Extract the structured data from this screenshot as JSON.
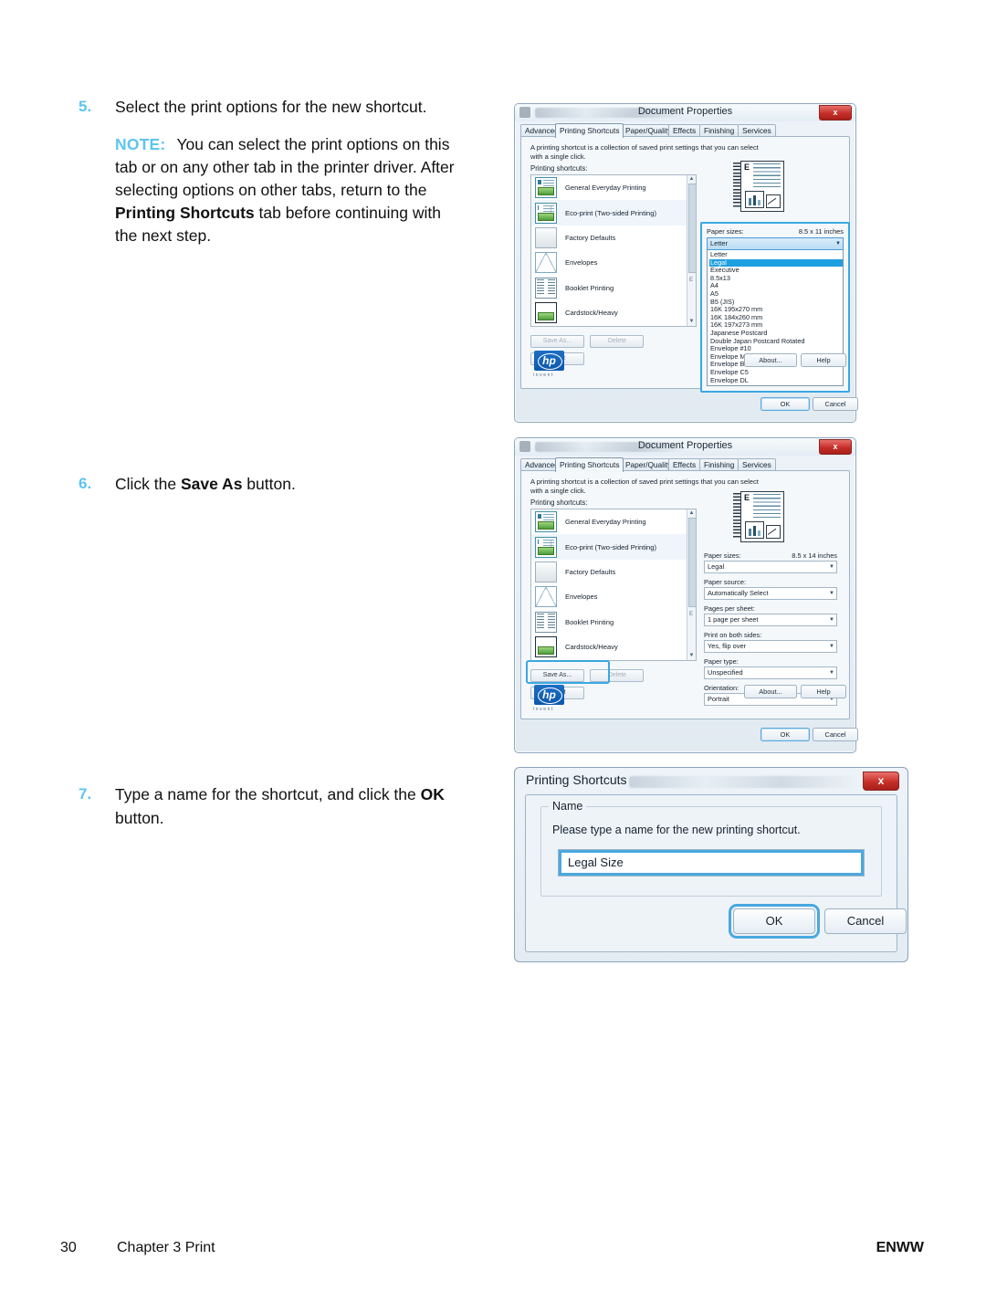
{
  "document": {
    "footer": {
      "page_number": "30",
      "chapter": "Chapter 3   Print",
      "guide_code": "ENWW"
    }
  },
  "steps": [
    {
      "number": "5.",
      "text": "Select the print options for the new shortcut.",
      "note": {
        "label": "NOTE:",
        "body_1": "You can select the print options on this tab or on any other tab in the printer driver. After selecting options on other tabs, return to the ",
        "bold": "Printing Shortcuts",
        "body_2": " tab before continuing with the next step."
      }
    },
    {
      "number": "6.",
      "text_1": "Click the ",
      "bold": "Save As",
      "text_2": " button."
    },
    {
      "number": "7.",
      "text_1": "Type a name for the shortcut, and click the ",
      "bold": "OK",
      "text_2": " button."
    }
  ],
  "dialog1": {
    "title": "Document Properties",
    "close_label": "x",
    "tabs": [
      "Advanced",
      "Printing Shortcuts",
      "Paper/Quality",
      "Effects",
      "Finishing",
      "Services"
    ],
    "active_tab": "Printing Shortcuts",
    "blurb": "A printing shortcut is a collection of saved print settings that you can select with a single click.",
    "shortcuts_label": "Printing shortcuts:",
    "shortcuts": [
      "General Everyday Printing",
      "Eco-print (Two-sided Printing)",
      "Factory Defaults",
      "Envelopes",
      "Booklet Printing",
      "Cardstock/Heavy"
    ],
    "selected_shortcut": "Eco-print (Two-sided Printing)",
    "mini_buttons": [
      "Save As...",
      "Delete",
      "Reset"
    ],
    "paper_size_label": "Paper sizes:",
    "paper_size_value_readout": "8.5 x 11 inches",
    "paper_size_selected": "Letter",
    "paper_size_highlighted": "Legal",
    "paper_size_options": [
      "Letter",
      "Legal",
      "Executive",
      "8.5x13",
      "A4",
      "A5",
      "B5 (JIS)",
      "16K 195x270 mm",
      "16K 184x260 mm",
      "16K 197x273 mm",
      "Japanese Postcard",
      "Double Japan Postcard Rotated",
      "Envelope #10",
      "Envelope Monarch",
      "Envelope B5",
      "Envelope C5",
      "Envelope DL"
    ],
    "about_label": "About...",
    "help_label": "Help",
    "ok_label": "OK",
    "cancel_label": "Cancel",
    "brand": "hp",
    "brand_tag": "invent"
  },
  "dialog2": {
    "title": "Document Properties",
    "close_label": "x",
    "tabs": [
      "Advanced",
      "Printing Shortcuts",
      "Paper/Quality",
      "Effects",
      "Finishing",
      "Services"
    ],
    "active_tab": "Printing Shortcuts",
    "blurb": "A printing shortcut is a collection of saved print settings that you can select with a single click.",
    "shortcuts_label": "Printing shortcuts:",
    "shortcuts": [
      "General Everyday Printing",
      "Eco-print (Two-sided Printing)",
      "Factory Defaults",
      "Envelopes",
      "Booklet Printing",
      "Cardstock/Heavy"
    ],
    "selected_shortcut": "Eco-print (Two-sided Printing)",
    "mini_buttons": [
      "Save As...",
      "Delete",
      "Reset"
    ],
    "settings": [
      {
        "label": "Paper sizes:",
        "readout": "8.5 x 14 inches",
        "value": "Legal"
      },
      {
        "label": "Paper source:",
        "readout": "",
        "value": "Automatically Select"
      },
      {
        "label": "Pages per sheet:",
        "readout": "",
        "value": "1 page per sheet"
      },
      {
        "label": "Print on both sides:",
        "readout": "",
        "value": "Yes, flip over"
      },
      {
        "label": "Paper type:",
        "readout": "",
        "value": "Unspecified"
      },
      {
        "label": "Orientation:",
        "readout": "",
        "value": "Portrait"
      }
    ],
    "about_label": "About...",
    "help_label": "Help",
    "ok_label": "OK",
    "cancel_label": "Cancel",
    "brand": "hp",
    "brand_tag": "invent"
  },
  "dialog3": {
    "title": "Printing Shortcuts",
    "close_label": "x",
    "group_title": "Name",
    "prompt": "Please type a name for the new printing shortcut.",
    "input_value": "Legal Size",
    "ok_label": "OK",
    "cancel_label": "Cancel"
  },
  "colors": {
    "step_number": "#5cc5ef",
    "highlight_border": "#3ba7e0",
    "selection_blue": "#1e9fe0",
    "close_red": "#c62f28",
    "hp_blue": "#0b58ad"
  }
}
